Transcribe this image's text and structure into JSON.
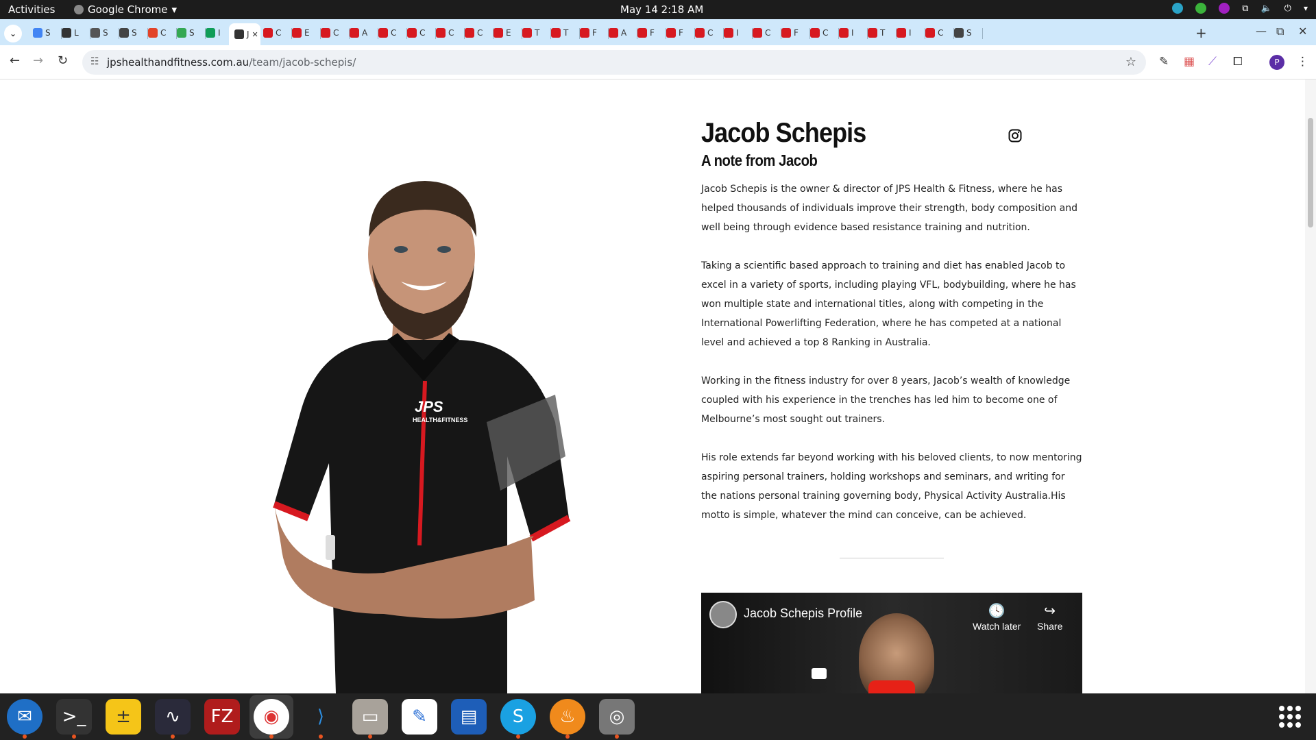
{
  "system": {
    "activities": "Activities",
    "app_name": "Google Chrome",
    "clock": "May 14  2:18 AM"
  },
  "browser": {
    "tabs": [
      {
        "glyph": "S",
        "color": "#4285f4"
      },
      {
        "glyph": "L",
        "color": "#333333"
      },
      {
        "glyph": "S",
        "color": "#555555"
      },
      {
        "glyph": "S",
        "color": "#444444"
      },
      {
        "glyph": "C",
        "color": "#e24329"
      },
      {
        "glyph": "S",
        "color": "#34a853"
      },
      {
        "glyph": "I",
        "color": "#0f9d58"
      },
      {
        "glyph": "J",
        "color": "#333333",
        "active": true
      },
      {
        "glyph": "C",
        "color": "#d71920"
      },
      {
        "glyph": "E",
        "color": "#d71920"
      },
      {
        "glyph": "C",
        "color": "#d71920"
      },
      {
        "glyph": "A",
        "color": "#d71920"
      },
      {
        "glyph": "C",
        "color": "#d71920"
      },
      {
        "glyph": "C",
        "color": "#d71920"
      },
      {
        "glyph": "C",
        "color": "#d71920"
      },
      {
        "glyph": "C",
        "color": "#d71920"
      },
      {
        "glyph": "E",
        "color": "#d71920"
      },
      {
        "glyph": "T",
        "color": "#d71920"
      },
      {
        "glyph": "T",
        "color": "#d71920"
      },
      {
        "glyph": "F",
        "color": "#d71920"
      },
      {
        "glyph": "A",
        "color": "#d71920"
      },
      {
        "glyph": "F",
        "color": "#d71920"
      },
      {
        "glyph": "F",
        "color": "#d71920"
      },
      {
        "glyph": "C",
        "color": "#d71920"
      },
      {
        "glyph": "I",
        "color": "#d71920"
      },
      {
        "glyph": "C",
        "color": "#d71920"
      },
      {
        "glyph": "F",
        "color": "#d71920"
      },
      {
        "glyph": "C",
        "color": "#d71920"
      },
      {
        "glyph": "I",
        "color": "#d71920"
      },
      {
        "glyph": "T",
        "color": "#d71920"
      },
      {
        "glyph": "I",
        "color": "#d71920"
      },
      {
        "glyph": "C",
        "color": "#d71920"
      },
      {
        "glyph": "S",
        "color": "#444444"
      }
    ],
    "url_host": "jpshealthandfitness.com.au",
    "url_path": "/team/jacob-schepis/",
    "profile_initial": "P"
  },
  "page": {
    "name": "Jacob Schepis",
    "subtitle": "A note from Jacob",
    "paragraphs": [
      "Jacob Schepis is the owner & director of JPS Health & Fitness, where he has helped thousands of individuals improve their strength, body composition and well being through evidence based resistance training and nutrition.",
      "Taking a scientific based approach to training and diet has enabled Jacob to excel in a variety of sports, including playing VFL, bodybuilding, where he has won multiple state and international titles, along with competing in the International Powerlifting Federation, where he has competed at a national level and achieved a top 8 Ranking in Australia.",
      "Working in the fitness industry for over 8 years, Jacob’s wealth of knowledge coupled with his experience in the trenches has led him to become one of Melbourne’s most sought out trainers.",
      "His role extends far beyond working with his beloved clients, to now mentoring aspiring personal trainers, holding workshops and seminars, and writing for the nations personal training governing body, Physical Activity Australia.His motto is simple, whatever the mind can conceive, can be achieved."
    ],
    "shirt_logo": "JPS",
    "shirt_logo_sub": "HEALTH&FITNESS",
    "video": {
      "title": "Jacob Schepis Profile",
      "watch_later": "Watch later",
      "share": "Share"
    }
  },
  "colors": {
    "brand_red": "#d71920",
    "tab_strip": "#cfe8fb",
    "dock": "#222222"
  }
}
